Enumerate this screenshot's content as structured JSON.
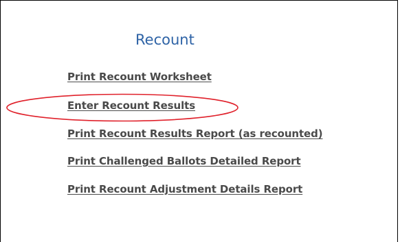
{
  "recount": {
    "title": "Recount",
    "links": [
      "Print Recount Worksheet",
      "Enter Recount Results",
      "Print Recount Results Report (as recounted)",
      "Print Challenged Ballots Detailed Report",
      "Print Recount Adjustment Details Report"
    ]
  },
  "annotation": {
    "highlight_color": "#e0202a"
  }
}
